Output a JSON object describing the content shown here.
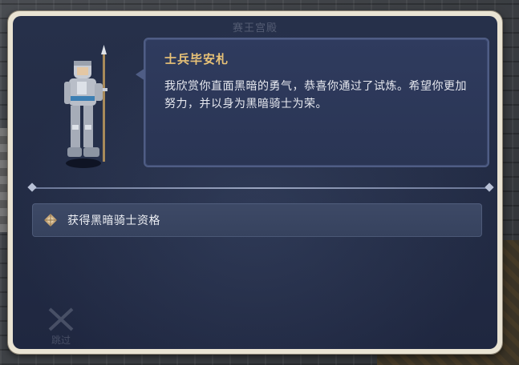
{
  "dialog": {
    "title": "赛王宫殿"
  },
  "speaker": {
    "name": "士兵毕安札"
  },
  "speech": {
    "text": "我欣赏你直面黑暗的勇气，恭喜你通过了试炼。希望你更加努力，并以身为黑暗骑士为荣。"
  },
  "options": [
    {
      "label": "获得黑暗骑士资格",
      "icon": "diamond-icon"
    }
  ],
  "skip": {
    "label": "跳过",
    "icon": "crossed-swords-icon"
  },
  "colors": {
    "speaker_name": "#e8c277",
    "panel_bg": "#26304a",
    "frame": "#e9e3d3"
  }
}
